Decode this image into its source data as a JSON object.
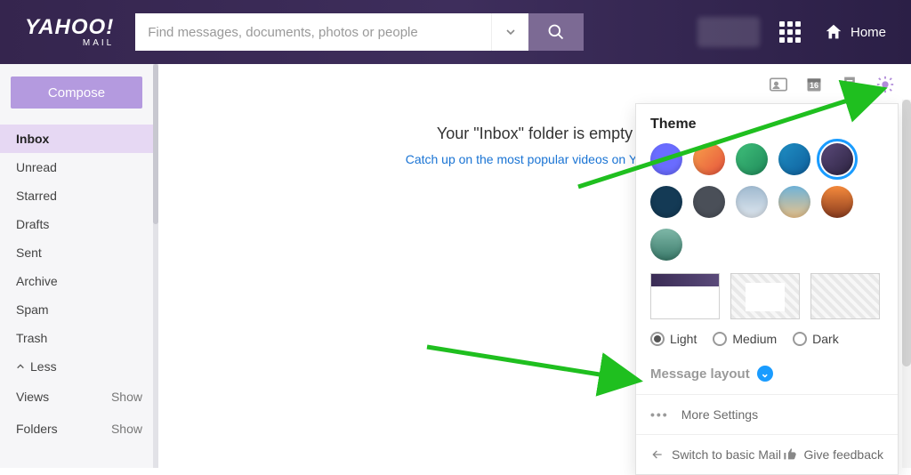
{
  "header": {
    "logo": "YAHOO!",
    "logo_sub": "MAIL",
    "search_placeholder": "Find messages, documents, photos or people",
    "home_label": "Home"
  },
  "sidebar": {
    "compose_label": "Compose",
    "folders": [
      "Inbox",
      "Unread",
      "Starred",
      "Drafts",
      "Sent",
      "Archive",
      "Spam",
      "Trash"
    ],
    "active_index": 0,
    "less_label": "Less",
    "views_label": "Views",
    "folders_section_label": "Folders",
    "show_label": "Show"
  },
  "main": {
    "empty_title": "Your \"Inbox\" folder is empty",
    "empty_link": "Catch up on the most popular videos on Yahoo",
    "calendar_day": "16"
  },
  "settings": {
    "theme_label": "Theme",
    "swatches": [
      {
        "name": "blue",
        "color": "#6a6cff"
      },
      {
        "name": "orange",
        "color": "linear-gradient(135deg,#f7a14a,#e7533d)"
      },
      {
        "name": "green",
        "color": "linear-gradient(135deg,#3fbf7a,#1f8a5a)"
      },
      {
        "name": "teal",
        "color": "linear-gradient(135deg,#1f8fc4,#0f5f9c)"
      },
      {
        "name": "purple",
        "color": "linear-gradient(135deg,#5a4a7a,#2d2340)"
      },
      {
        "name": "navy",
        "color": "#143a55"
      },
      {
        "name": "slate",
        "color": "#4a4f58"
      },
      {
        "name": "sky",
        "color": "linear-gradient(180deg,#9fb9cf,#dfe7ef)"
      },
      {
        "name": "beach",
        "color": "linear-gradient(180deg,#6fb3d9,#e9c28a)"
      },
      {
        "name": "sunset",
        "color": "linear-gradient(180deg,#f58a3c,#8a3c1f)"
      },
      {
        "name": "forest",
        "color": "linear-gradient(180deg,#7fb8a8,#3a7a6a)"
      }
    ],
    "selected_swatch": 4,
    "density": {
      "options": [
        "Light",
        "Medium",
        "Dark"
      ],
      "selected": 0
    },
    "message_layout_label": "Message layout",
    "more_settings_label": "More Settings",
    "switch_basic_label": "Switch to basic Mail",
    "feedback_label": "Give feedback"
  }
}
